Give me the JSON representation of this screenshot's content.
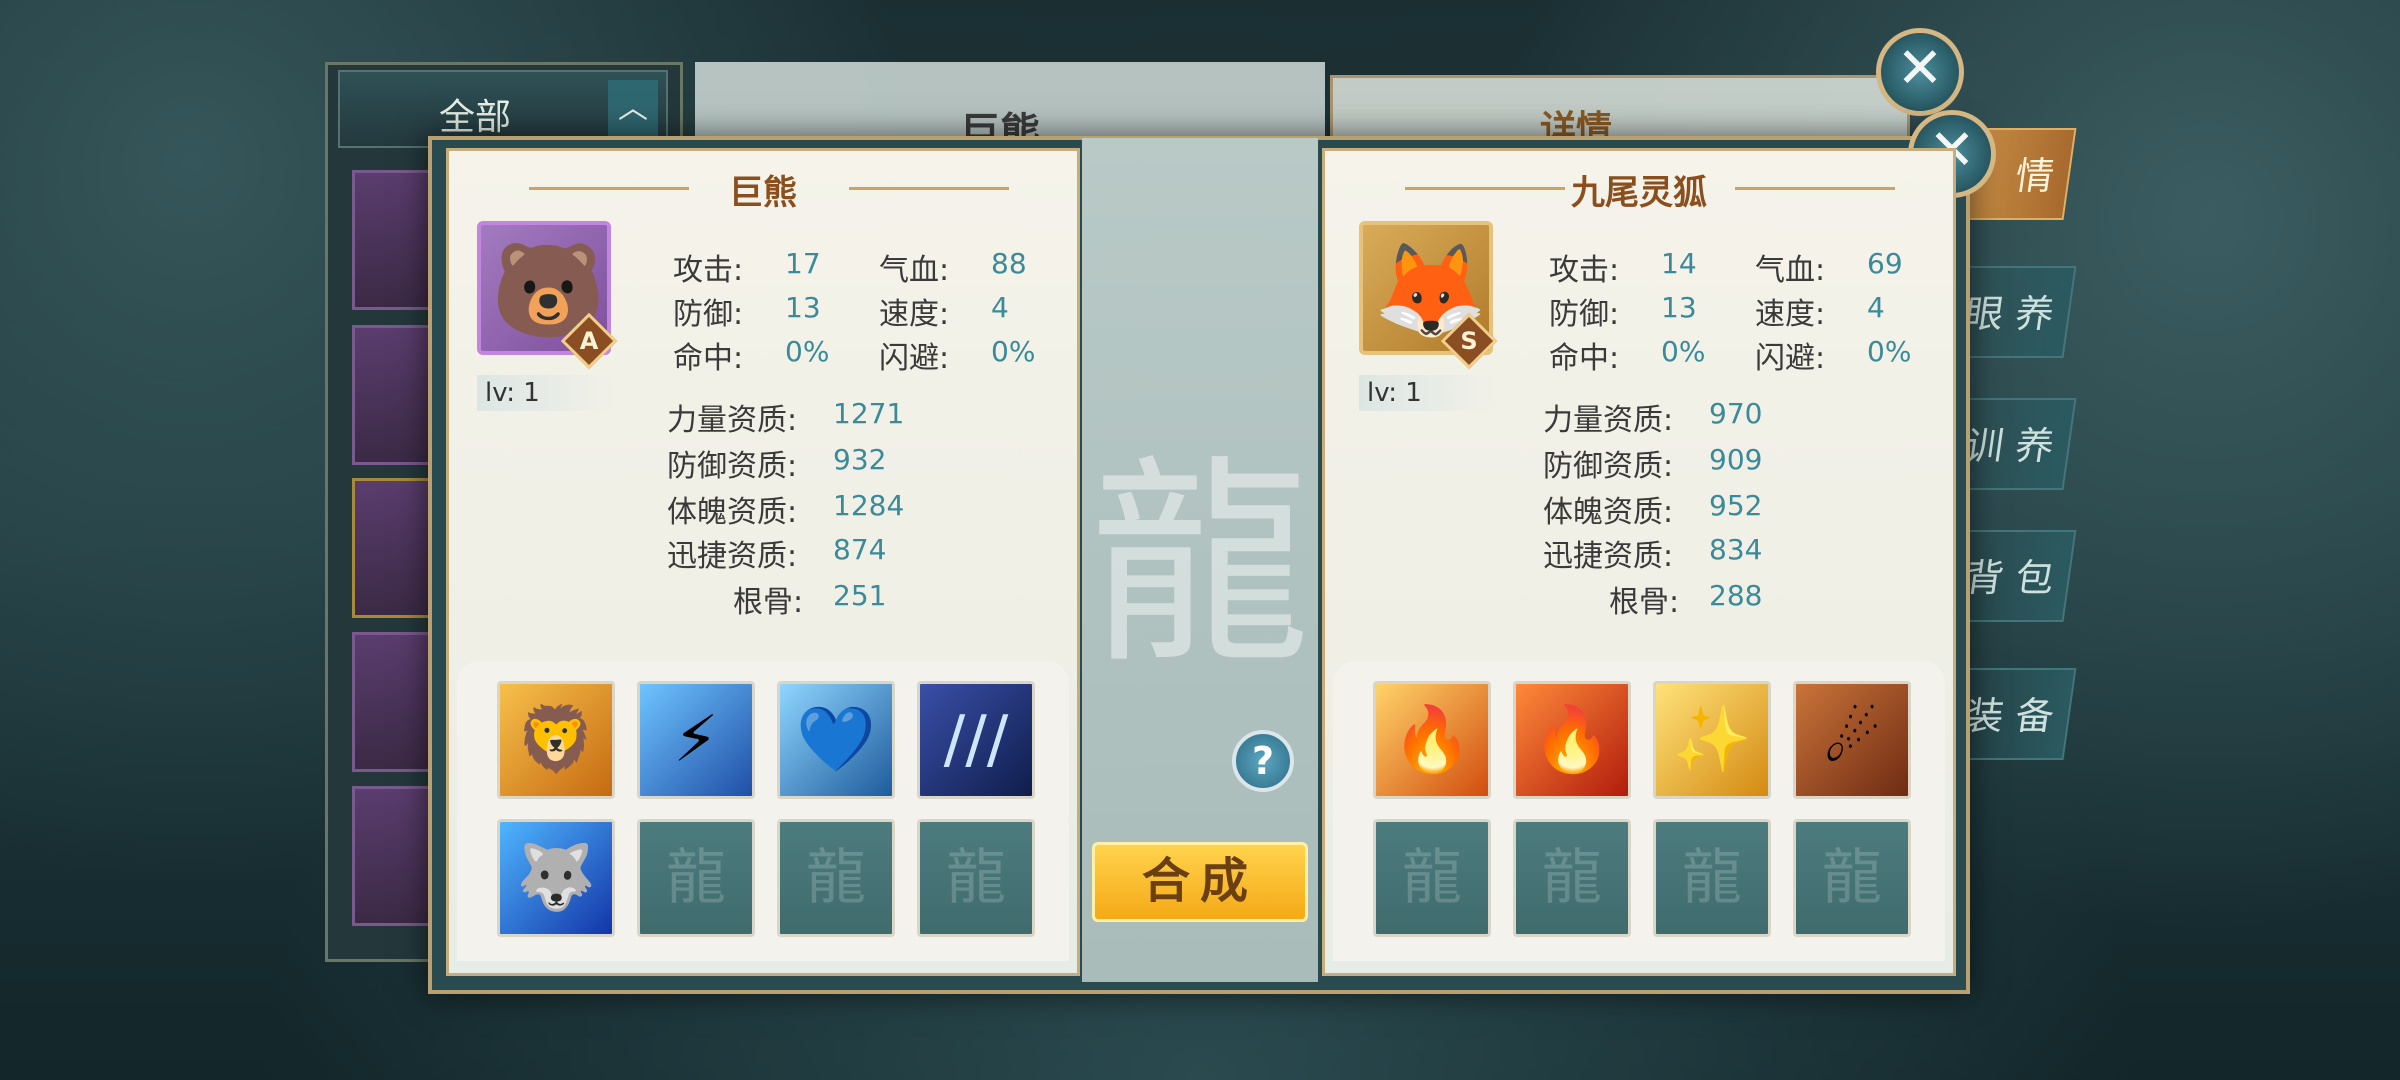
{
  "background": {
    "filter_label": "全部",
    "mid_title": "巨熊",
    "right_title": "详情",
    "tabs": [
      "情",
      "眼 养",
      "训 养",
      "背 包",
      "装 备"
    ]
  },
  "dialog": {
    "compose_label": "合成",
    "help_label": "?",
    "close_label": "✕"
  },
  "left_pet": {
    "name": "巨熊",
    "grade": "A",
    "level": "lv: 1",
    "avatar_icon": "bear-icon",
    "stats": [
      {
        "label": "攻击:",
        "value": "17"
      },
      {
        "label": "气血:",
        "value": "88"
      },
      {
        "label": "防御:",
        "value": "13"
      },
      {
        "label": "速度:",
        "value": "4"
      },
      {
        "label": "命中:",
        "value": "0%"
      },
      {
        "label": "闪避:",
        "value": "0%"
      }
    ],
    "aptitudes": [
      {
        "label": "力量资质:",
        "value": "1271"
      },
      {
        "label": "防御资质:",
        "value": "932"
      },
      {
        "label": "体魄资质:",
        "value": "1284"
      },
      {
        "label": "迅捷资质:",
        "value": "874"
      },
      {
        "label": "根骨:",
        "value": "251"
      }
    ],
    "skills": [
      "roar-skill-icon",
      "lightning-skill-icon",
      "heart-shield-skill-icon",
      "claw-skill-icon",
      "blue-beast-skill-icon",
      "empty",
      "empty",
      "empty"
    ]
  },
  "right_pet": {
    "name": "九尾灵狐",
    "grade": "S",
    "level": "lv: 1",
    "avatar_icon": "fox-icon",
    "stats": [
      {
        "label": "攻击:",
        "value": "14"
      },
      {
        "label": "气血:",
        "value": "69"
      },
      {
        "label": "防御:",
        "value": "13"
      },
      {
        "label": "速度:",
        "value": "4"
      },
      {
        "label": "命中:",
        "value": "0%"
      },
      {
        "label": "闪避:",
        "value": "0%"
      }
    ],
    "aptitudes": [
      {
        "label": "力量资质:",
        "value": "970"
      },
      {
        "label": "防御资质:",
        "value": "909"
      },
      {
        "label": "体魄资质:",
        "value": "952"
      },
      {
        "label": "迅捷资质:",
        "value": "834"
      },
      {
        "label": "根骨:",
        "value": "288"
      }
    ],
    "skills": [
      "fire-slash-skill-icon",
      "flame-skill-icon",
      "golden-light-skill-icon",
      "fireball-skill-icon",
      "empty",
      "empty",
      "empty",
      "empty"
    ]
  }
}
